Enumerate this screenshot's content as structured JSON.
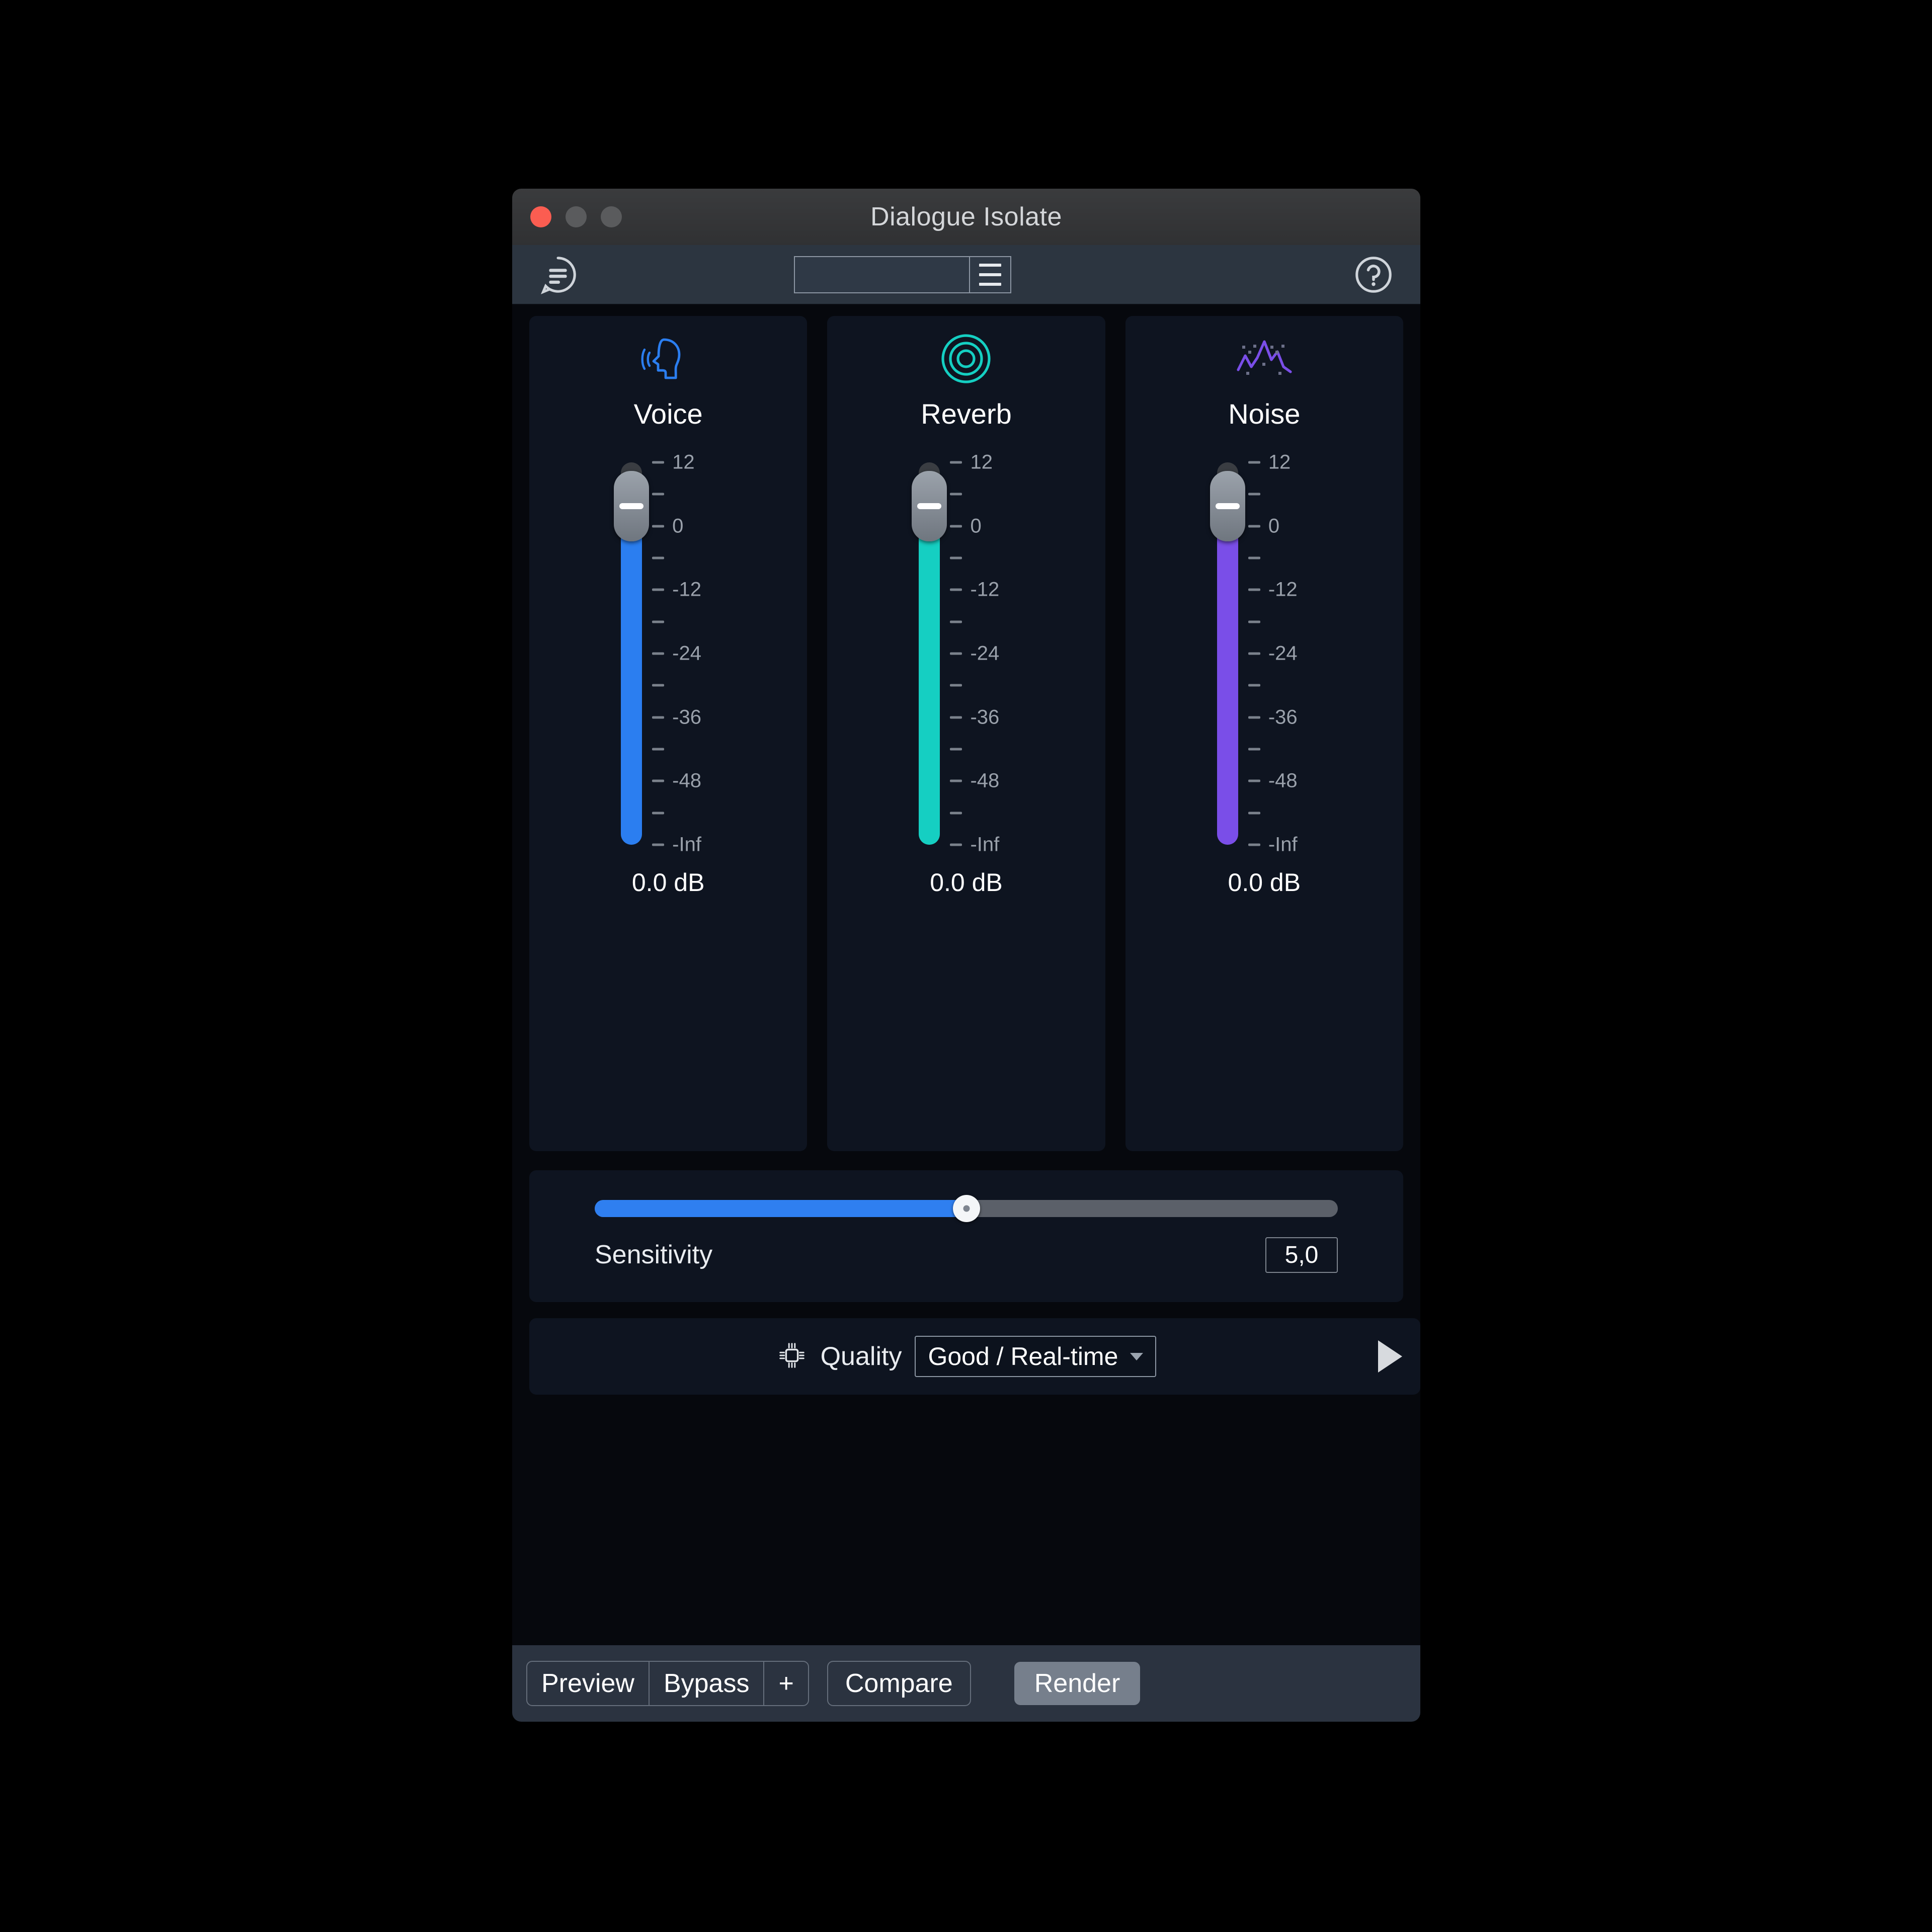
{
  "window": {
    "title": "Dialogue Isolate",
    "traffic_lights": [
      "close",
      "minimize",
      "maximize"
    ]
  },
  "toolbar": {
    "comment_icon": "comment-bubble-icon",
    "help_icon": "help-circle-icon",
    "preset_value": "",
    "preset_placeholder": "",
    "menu_icon": "hamburger-menu-icon"
  },
  "modules": [
    {
      "name": "Voice",
      "icon": "speaking-head-icon",
      "color": "#2b7ef0",
      "value": "0.0 dB",
      "handle_pos_pct": 11.5
    },
    {
      "name": "Reverb",
      "icon": "concentric-rings-icon",
      "color": "#15cfc2",
      "value": "0.0 dB",
      "handle_pos_pct": 11.5
    },
    {
      "name": "Noise",
      "icon": "noise-waveform-icon",
      "color": "#7a4ee8",
      "value": "0.0 dB",
      "handle_pos_pct": 11.5
    }
  ],
  "fader_scale": {
    "labels": [
      "12",
      "",
      "0",
      "",
      "-12",
      "",
      "-24",
      "",
      "-36",
      "",
      "-48",
      "",
      "-Inf"
    ],
    "unit": "dB"
  },
  "sensitivity": {
    "label": "Sensitivity",
    "value": "5,0",
    "fill_pct": 50,
    "accent": "#2f7ff0"
  },
  "quality": {
    "icon": "cpu-chip-icon",
    "label": "Quality",
    "selected": "Good / Real-time",
    "chevron": "chevron-down-icon",
    "play_icon": "play-triangle-icon"
  },
  "footer": {
    "preview": "Preview",
    "bypass": "Bypass",
    "add": "+",
    "compare": "Compare",
    "render": "Render"
  }
}
